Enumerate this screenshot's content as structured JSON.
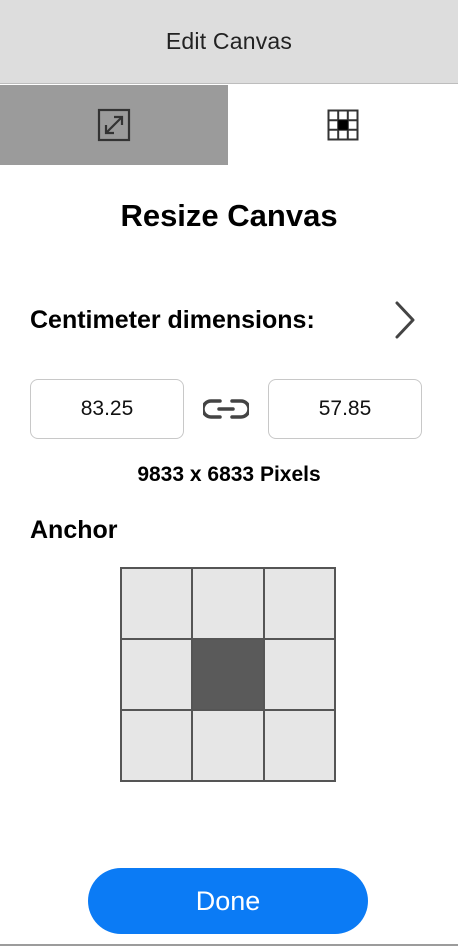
{
  "header": {
    "title": "Edit Canvas"
  },
  "tabs": [
    {
      "icon": "resize-icon",
      "active": true
    },
    {
      "icon": "anchor-grid-icon",
      "active": false
    }
  ],
  "main": {
    "title": "Resize Canvas",
    "dimensions_label": "Centimeter dimensions:",
    "width_value": "83.25",
    "height_value": "57.85",
    "link_icon": "link-icon",
    "pixels_text": "9833 x 6833 Pixels",
    "anchor_label": "Anchor",
    "anchor_selected": "center"
  },
  "footer": {
    "done_label": "Done"
  },
  "colors": {
    "header_bg": "#dddddd",
    "active_tab_bg": "#9b9b9b",
    "accent": "#0b7bf5",
    "anchor_selected": "#5a5a5a",
    "anchor_cell": "#e6e6e6"
  }
}
